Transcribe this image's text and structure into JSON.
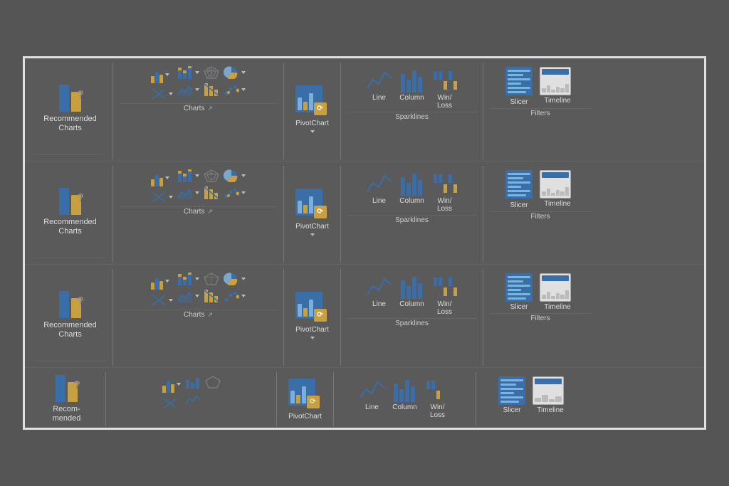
{
  "rows": [
    {
      "id": "row1",
      "sections": [
        {
          "id": "recommended-charts",
          "label": "Recommended Charts",
          "type": "recommended"
        },
        {
          "id": "charts",
          "label": "Charts",
          "type": "charts"
        },
        {
          "id": "pivotchart",
          "label": "PivotChart",
          "type": "pivotchart"
        },
        {
          "id": "sparklines",
          "label": "Sparklines",
          "type": "sparklines",
          "items": [
            "Line",
            "Column",
            "Win/\nLoss"
          ]
        },
        {
          "id": "filters",
          "label": "Filters",
          "type": "filters",
          "items": [
            "Slicer",
            "Timeline"
          ]
        }
      ]
    }
  ],
  "labels": {
    "recommended_charts": "Recommended\nCharts",
    "charts": "Charts",
    "pivotchart": "PivotChart",
    "sparklines": "Sparklines",
    "filters": "Filters",
    "line": "Line",
    "column": "Column",
    "win_loss": "Win/\nLoss",
    "slicer": "Slicer",
    "timeline": "Timeline"
  }
}
